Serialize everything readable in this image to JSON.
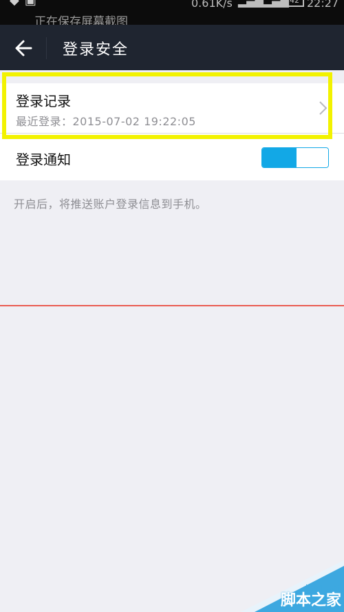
{
  "status_bar": {
    "notice": "正在保存屏幕截图",
    "net_speed": "0.61K/s",
    "battery": "42",
    "time": "22:27"
  },
  "header": {
    "title": "登录安全",
    "back_icon": "arrow-left-icon"
  },
  "login_record": {
    "title": "登录记录",
    "subtitle": "最近登录：2015-07-02 19:22:05",
    "chevron_icon": "chevron-right-icon"
  },
  "login_notification": {
    "title": "登录通知",
    "enabled": true
  },
  "hint": "开启后，将推送账户登录信息到手机。",
  "colors": {
    "header_bg": "#1f2530",
    "toggle_on": "#12a8e6",
    "highlight": "#f2f200",
    "annotation_line": "#ea5a50"
  },
  "watermark": {
    "url": "jb51.net",
    "name": "脚本之家"
  }
}
